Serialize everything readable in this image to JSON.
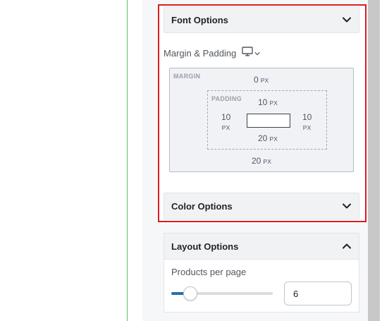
{
  "panel": {
    "font_options": {
      "label": "Font Options",
      "expanded": false
    },
    "margin_padding": {
      "label": "Margin & Padding",
      "device_icon": "desktop-icon",
      "margin": {
        "tag": "MARGIN",
        "top": {
          "value": "0",
          "unit": "PX"
        },
        "bottom": {
          "value": "20",
          "unit": "PX"
        }
      },
      "padding": {
        "tag": "PADDING",
        "top": {
          "value": "10",
          "unit": "PX"
        },
        "left": {
          "value": "10",
          "unit": "PX"
        },
        "right": {
          "value": "10",
          "unit": "PX"
        },
        "bottom": {
          "value": "20",
          "unit": "PX"
        }
      }
    },
    "color_options": {
      "label": "Color Options",
      "expanded": false
    },
    "layout_options": {
      "label": "Layout Options",
      "expanded": true,
      "products_per_page": {
        "label": "Products per page",
        "value": "6",
        "slider_fraction": 0.19
      }
    }
  },
  "colors": {
    "highlight": "#dd1c1c",
    "accent": "#2271b1",
    "canvas_divider": "#5fbe5f"
  }
}
